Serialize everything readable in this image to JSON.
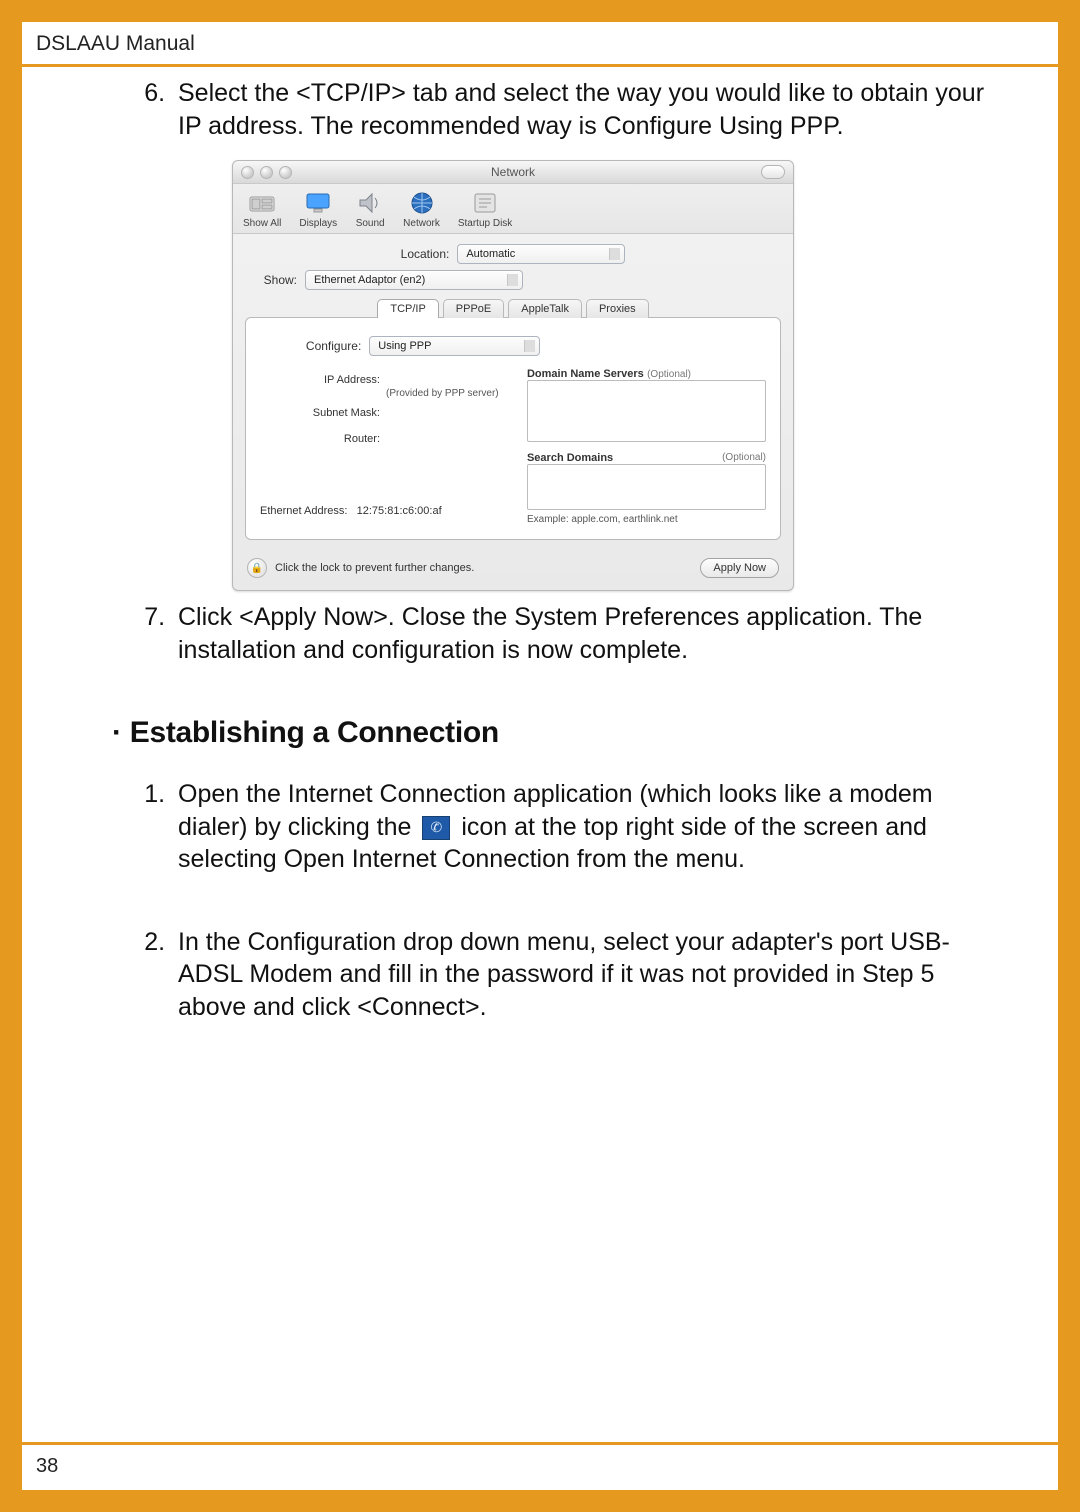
{
  "header": {
    "title": "DSLAAU Manual"
  },
  "steps_a_start": 6,
  "steps_a": [
    "Select the <TCP/IP> tab and select the way you would like to obtain your IP address.  The recommended way is Configure Using PPP.",
    "Click <Apply Now>.  Close the System Preferences application.  The installation and configuration is now complete."
  ],
  "section_heading": "Establishing a Connection",
  "steps_b_start": 1,
  "steps_b": [
    {
      "pre": "Open the Internet Connection application (which looks like a modem dialer) by clicking  the ",
      "post": " icon at the top right side of the screen and selecting Open Internet Connection from the menu."
    },
    {
      "text": "In the Configuration drop down menu, select your adapter's port USB-ADSL Modem and fill in the password if it was not provided in Step 5 above and click <Connect>."
    }
  ],
  "page_number": "38",
  "prefs": {
    "window_title": "Network",
    "toolbar": {
      "show_all": "Show All",
      "displays": "Displays",
      "sound": "Sound",
      "network": "Network",
      "startup_disk": "Startup Disk"
    },
    "location_label": "Location:",
    "location_value": "Automatic",
    "show_label": "Show:",
    "show_value": "Ethernet Adaptor (en2)",
    "tabs": {
      "tcpip": "TCP/IP",
      "pppoe": "PPPoE",
      "appletalk": "AppleTalk",
      "proxies": "Proxies"
    },
    "configure_label": "Configure:",
    "configure_value": "Using PPP",
    "ip_address_label": "IP Address:",
    "ip_address_caption": "(Provided by PPP server)",
    "subnet_mask_label": "Subnet Mask:",
    "router_label": "Router:",
    "dns_label": "Domain Name Servers",
    "dns_optional": "(Optional)",
    "search_domains_label": "Search Domains",
    "search_domains_optional": "(Optional)",
    "example_text": "Example: apple.com, earthlink.net",
    "eth_addr_label": "Ethernet Address:",
    "eth_addr_value": "12:75:81:c6:00:af",
    "lock_text": "Click the lock to prevent further changes.",
    "apply_now": "Apply Now"
  }
}
